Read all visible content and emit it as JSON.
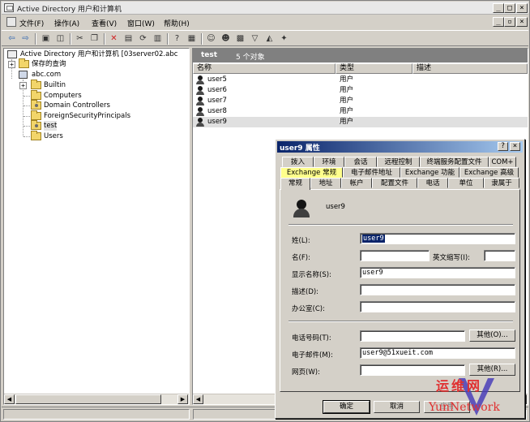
{
  "window": {
    "title": "Active Directory 用户和计算机",
    "btn_min": "_",
    "btn_max": "□",
    "btn_close": "×"
  },
  "menu": {
    "items": [
      "文件(F)",
      "操作(A)",
      "查看(V)",
      "窗口(W)",
      "帮助(H)"
    ],
    "inner_btn_min": "_",
    "inner_btn_max": "▫",
    "inner_btn_close": "×"
  },
  "tree": {
    "root": "Active Directory 用户和计算机 [03server02.abc",
    "saved_queries": "保存的查询",
    "domain": "abc.com",
    "items": [
      "Builtin",
      "Computers",
      "Domain Controllers",
      "ForeignSecurityPrincipals",
      "test",
      "Users"
    ],
    "expand_plus": "+"
  },
  "list": {
    "title": "test",
    "count": "5 个对象",
    "col_name": "名称",
    "col_type": "类型",
    "col_desc": "描述",
    "rows": [
      {
        "name": "user5",
        "type": "用户"
      },
      {
        "name": "user6",
        "type": "用户"
      },
      {
        "name": "user7",
        "type": "用户"
      },
      {
        "name": "user8",
        "type": "用户"
      },
      {
        "name": "user9",
        "type": "用户"
      }
    ]
  },
  "dialog": {
    "title": "user9 属性",
    "btn_help": "?",
    "btn_close": "×",
    "tabs_row1": [
      "拨入",
      "环境",
      "会话",
      "远程控制",
      "终端服务配置文件",
      "COM+"
    ],
    "tabs_row2": [
      "Exchange 常规",
      "电子邮件地址",
      "Exchange 功能",
      "Exchange 高级"
    ],
    "tabs_row3": [
      "常规",
      "地址",
      "帐户",
      "配置文件",
      "电话",
      "单位",
      "隶属于"
    ],
    "user_name": "user9",
    "labels": {
      "last_name": "姓(L):",
      "first_name": "名(F):",
      "initials": "英文缩写(I):",
      "display_name": "显示名称(S):",
      "description": "描述(D):",
      "office": "办公室(C):",
      "phone": "电话号码(T):",
      "email": "电子邮件(M):",
      "webpage": "网页(W):"
    },
    "values": {
      "last_name": "user9",
      "first_name": "",
      "initials": "",
      "display_name": "user9",
      "description": "",
      "office": "",
      "phone": "",
      "email": "user9@51xueit.com",
      "webpage": ""
    },
    "btn_other_phone": "其他(O)...",
    "btn_other_web": "其他(R)...",
    "btn_ok": "确定",
    "btn_cancel": "取消",
    "btn_apply": "应用"
  },
  "watermark": {
    "text_cn": "运维网",
    "text_en": "YunNetwork"
  },
  "colors": {
    "dialog_title_start": "#0a246a",
    "dialog_title_end": "#a6caf0",
    "tab_highlight": "#ffff8c",
    "list_header": "#808080",
    "watermark": "#e03030"
  }
}
